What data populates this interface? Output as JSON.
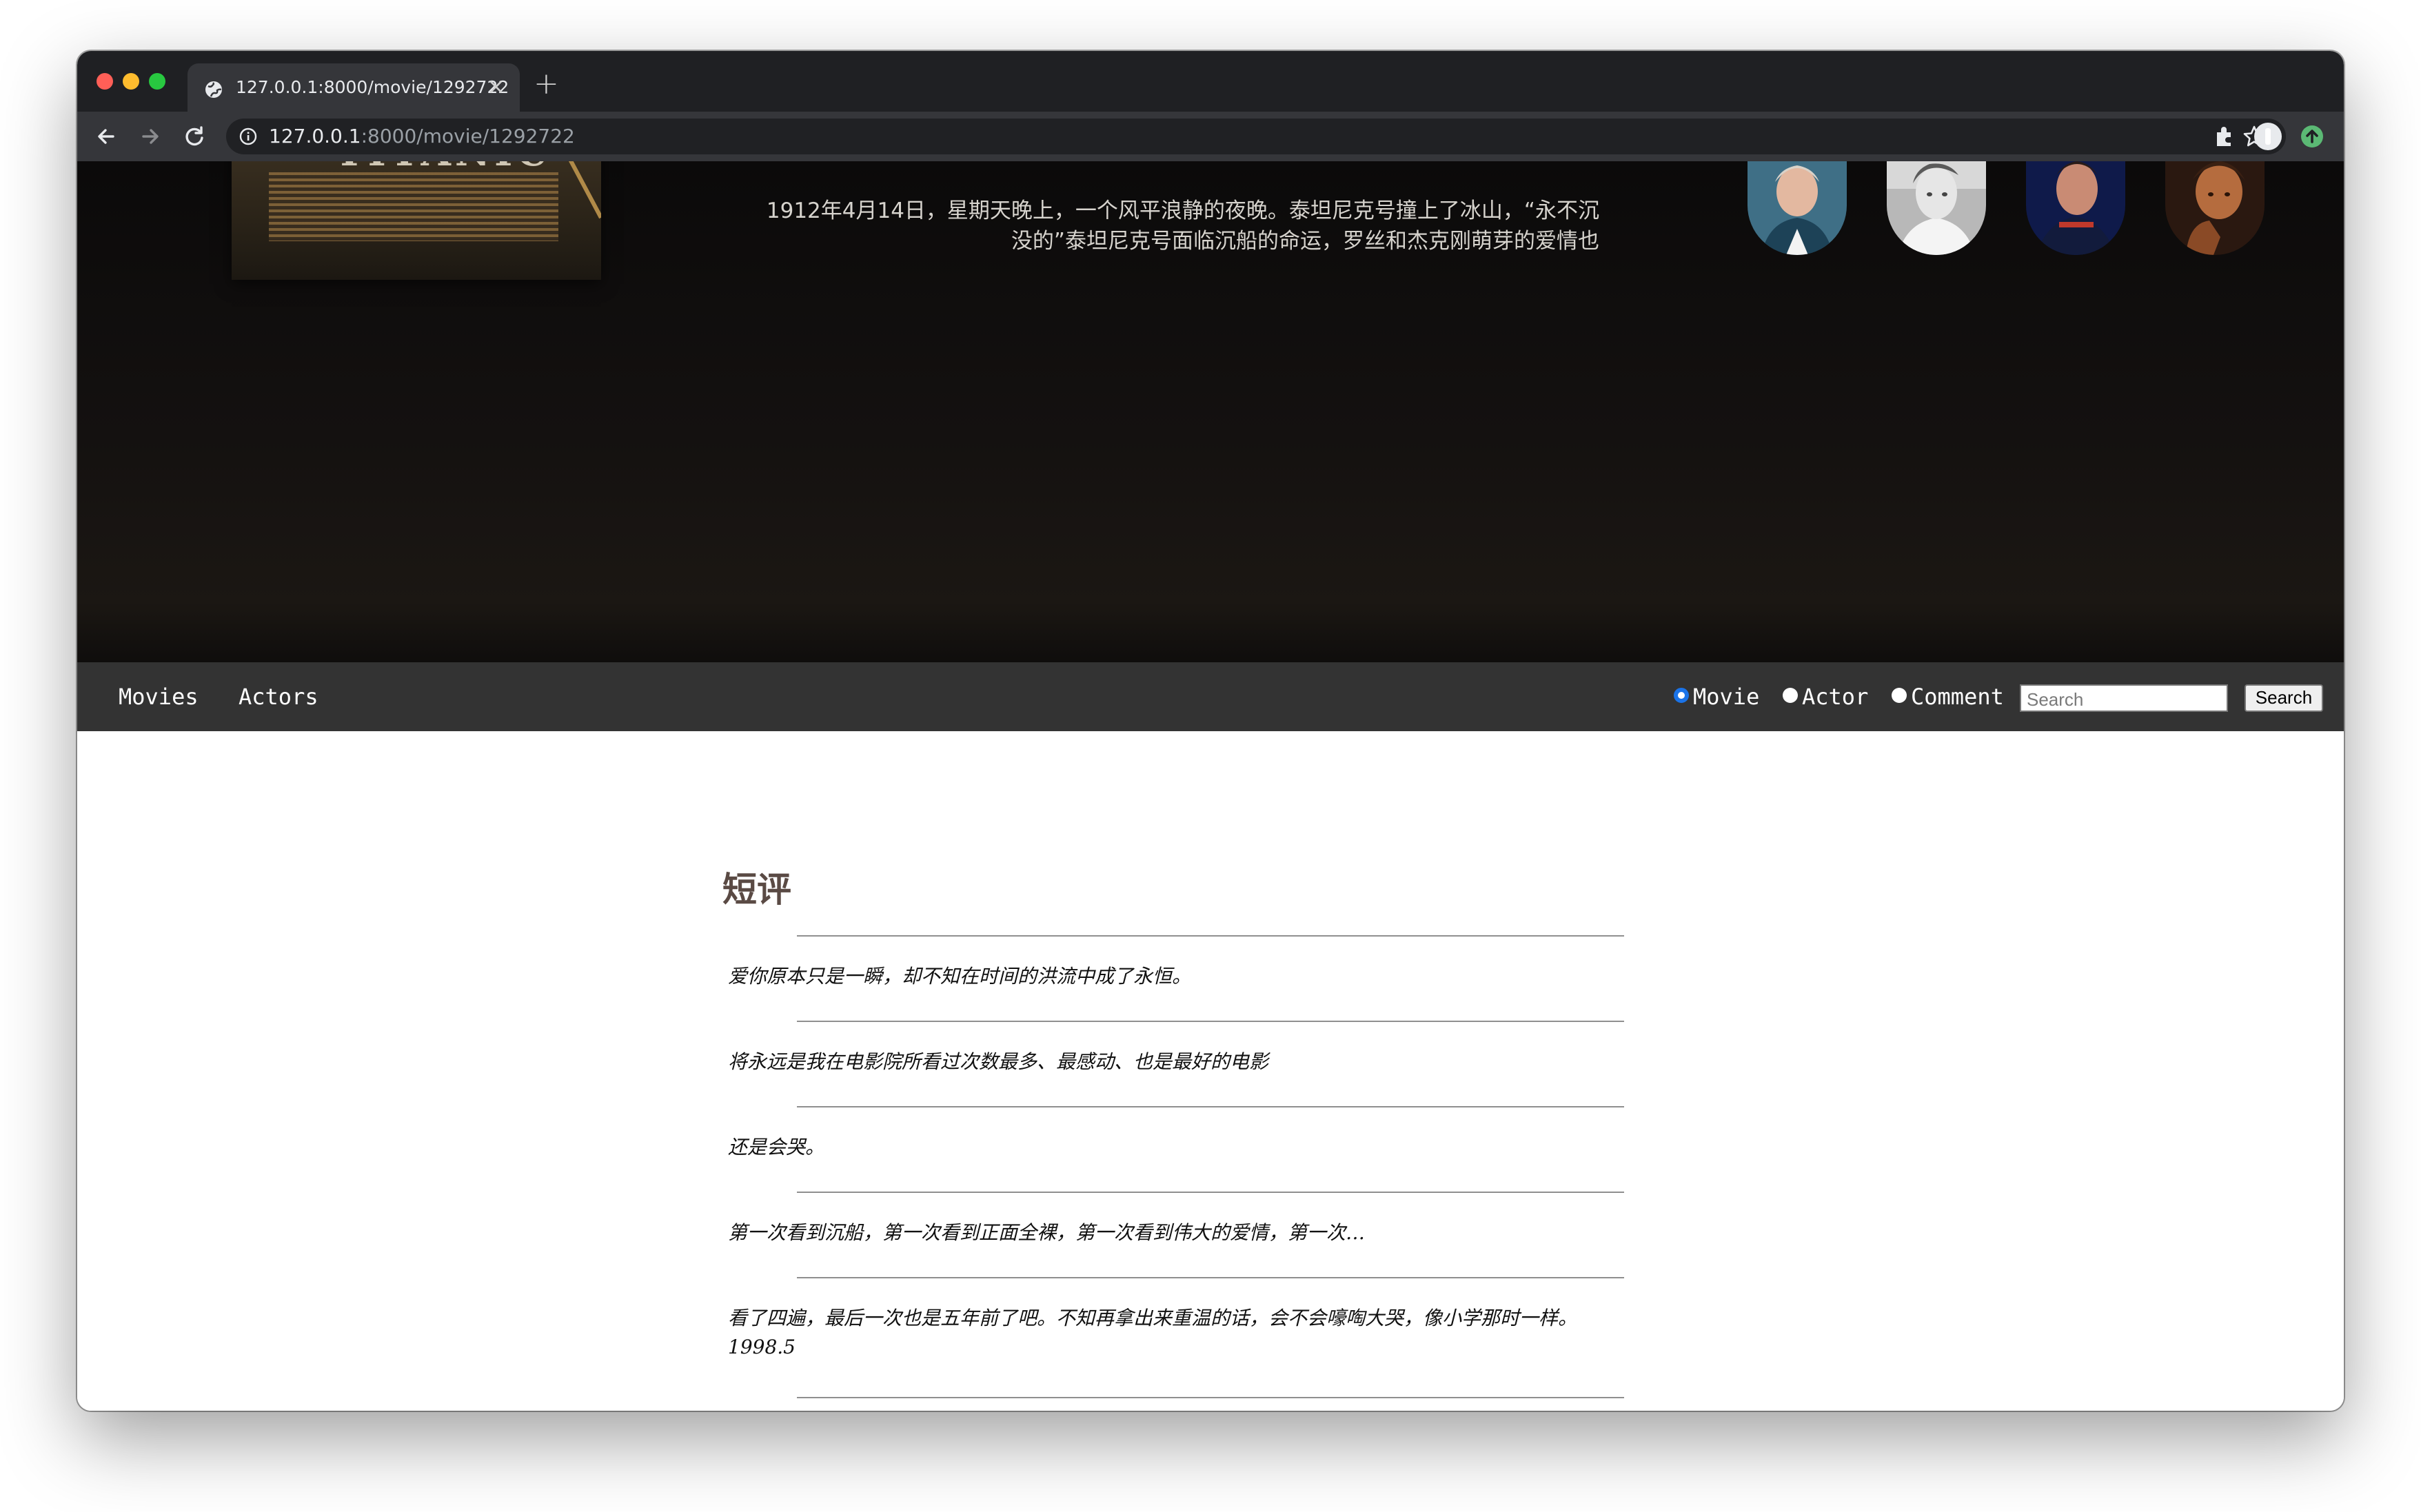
{
  "browser": {
    "tab_title": "127.0.0.1:8000/movie/1292722",
    "tab_close": "×",
    "new_tab": "+",
    "url_host": "127.0.0.1",
    "url_rest": ":8000/movie/1292722"
  },
  "movie": {
    "poster_title": "TITANIC",
    "synopsis": "1912年4月14日，星期天晚上，一个风平浪静的夜晚。泰坦尼克号撞上了冰山，“永不沉没的”泰坦尼克号面临沉船的命运，罗丝和杰克刚萌芽的爱情也"
  },
  "nav": {
    "movies": "Movies",
    "actors": "Actors",
    "radio_movie": "Movie",
    "radio_actor": "Actor",
    "radio_comment": "Comment",
    "search_placeholder": "Search",
    "search_button": "Search"
  },
  "reviews": {
    "title": "短评",
    "items": [
      "爱你原本只是一瞬，却不知在时间的洪流中成了永恒。",
      "将永远是我在电影院所看过次数最多、最感动、也是最好的电影",
      "还是会哭。",
      "第一次看到沉船，第一次看到正面全裸，第一次看到伟大的爱情，第一次…",
      "看了四遍，最后一次也是五年前了吧。不知再拿出来重温的话，会不会嚎啕大哭，像小学那时一样。",
      "1998.5"
    ]
  },
  "colors": {
    "tab_bar": "#1f2023",
    "toolbar": "#35363a",
    "navbar": "#333333",
    "radio_checked": "#1a73e8",
    "traffic_red": "#ff5f57",
    "traffic_yellow": "#febc2e",
    "traffic_green": "#28c840"
  }
}
